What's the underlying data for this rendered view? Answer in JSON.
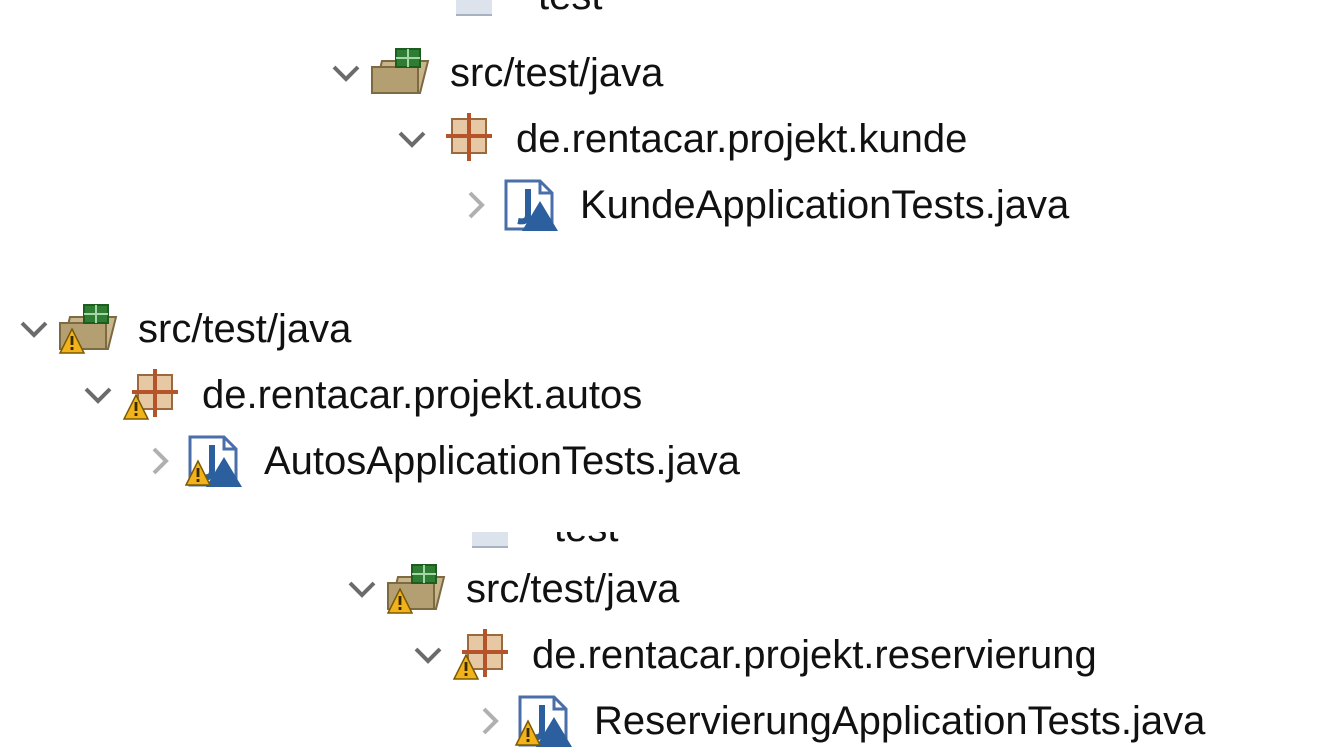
{
  "group1": {
    "partial_text": "test",
    "folder": {
      "label": "src/test/java",
      "expanded": true,
      "warning": false
    },
    "package": {
      "label": "de.rentacar.projekt.kunde",
      "expanded": true,
      "warning": false
    },
    "file": {
      "label": "KundeApplicationTests.java",
      "expanded": false,
      "warning": false
    }
  },
  "group2": {
    "folder": {
      "label": "src/test/java",
      "expanded": true,
      "warning": true
    },
    "package": {
      "label": "de.rentacar.projekt.autos",
      "expanded": true,
      "warning": true
    },
    "file": {
      "label": "AutosApplicationTests.java",
      "expanded": false,
      "warning": true
    }
  },
  "group3": {
    "partial_text": "test",
    "folder": {
      "label": "src/test/java",
      "expanded": true,
      "warning": true
    },
    "package": {
      "label": "de.rentacar.projekt.reservierung",
      "expanded": true,
      "warning": true
    },
    "file": {
      "label": "ReservierungApplicationTests.java",
      "expanded": false,
      "warning": true
    }
  },
  "colors": {
    "text": "#111111",
    "chevron_expanded": "#6b6b6b",
    "chevron_collapsed": "#b0b0b0",
    "folder": "#a08a5a",
    "package": "#b07a4a",
    "junit_blue": "#2b5f9e",
    "warning": "#f2b21b"
  }
}
